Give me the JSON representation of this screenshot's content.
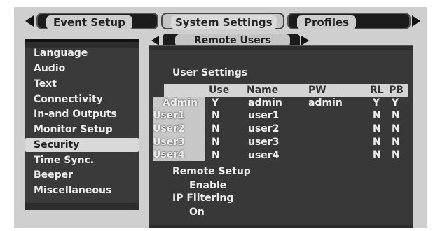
{
  "tabs": {
    "event_setup": "Event Setup",
    "system_settings": "System Settings",
    "profiles": "Profiles"
  },
  "left_menu": {
    "items": [
      "Language",
      "Audio",
      "Text",
      "Connectivity",
      "In-and Outputs",
      "Monitor Setup",
      "Security",
      "Time Sync.",
      "Beeper",
      "Miscellaneous"
    ],
    "active": "Security"
  },
  "sub_tab": {
    "label": "Remote Users"
  },
  "user_settings": {
    "title": "User Settings",
    "columns": [
      "Use",
      "Name",
      "PW",
      "RL",
      "PB"
    ],
    "rows": [
      {
        "label": "Admin",
        "use": "Y",
        "name": "admin",
        "pw": "admin",
        "rl": "Y",
        "pb": "Y"
      },
      {
        "label": "User1",
        "use": "N",
        "name": "user1",
        "pw": "",
        "rl": "N",
        "pb": "N"
      },
      {
        "label": "User2",
        "use": "N",
        "name": "user2",
        "pw": "",
        "rl": "N",
        "pb": "N"
      },
      {
        "label": "User3",
        "use": "N",
        "name": "user3",
        "pw": "",
        "rl": "N",
        "pb": "N"
      },
      {
        "label": "User4",
        "use": "N",
        "name": "user4",
        "pw": "",
        "rl": "N",
        "pb": "N"
      }
    ]
  },
  "remote_setup": {
    "label": "Remote Setup",
    "value": "Enable"
  },
  "ip_filtering": {
    "label": "IP Filtering",
    "value": "On"
  }
}
